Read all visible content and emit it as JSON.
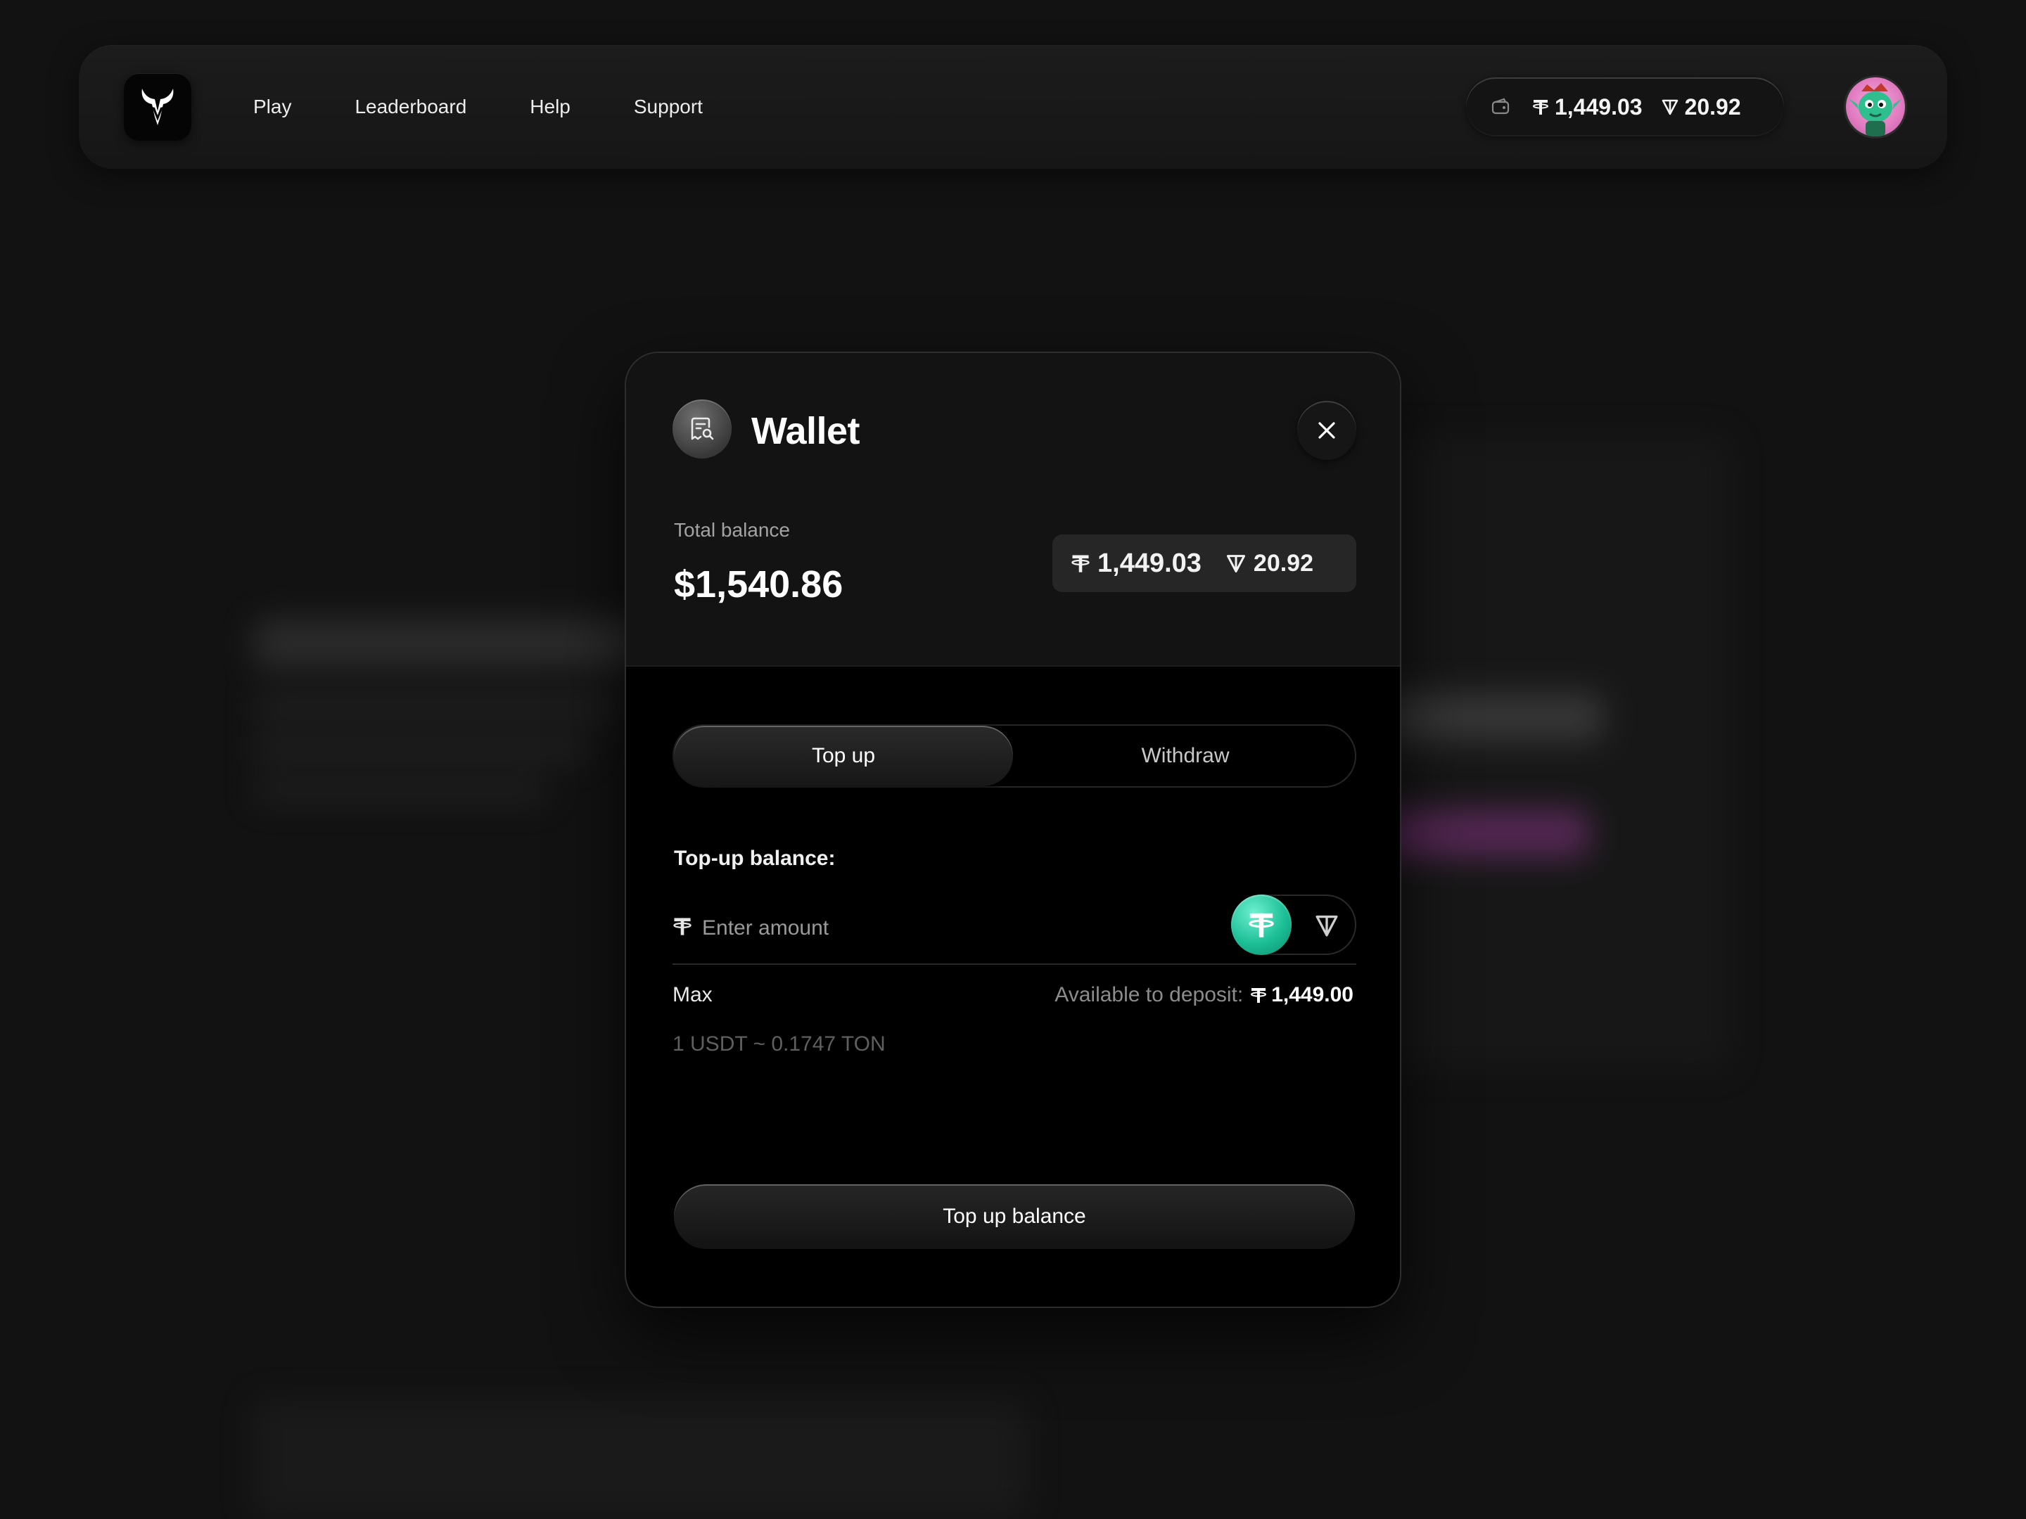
{
  "nav": {
    "items": [
      {
        "label": "Play"
      },
      {
        "label": "Leaderboard"
      },
      {
        "label": "Help"
      },
      {
        "label": "Support"
      }
    ],
    "balance": {
      "usdt": "1,449.03",
      "ton": "20.92"
    }
  },
  "modal": {
    "title": "Wallet",
    "total_label": "Total balance",
    "total_value": "$1,540.86",
    "coins": {
      "usdt": "1,449.03",
      "ton": "20.92"
    },
    "tabs": [
      {
        "label": "Top up",
        "active": true
      },
      {
        "label": "Withdraw",
        "active": false
      }
    ],
    "section_label": "Top-up balance:",
    "amount_placeholder": "Enter amount",
    "amount_value": "",
    "selected_currency": "USDT",
    "max_label": "Max",
    "available_label": "Available to deposit:",
    "available_value": "1,449.00",
    "rate": "1 USDT ~ 0.1747 TON",
    "submit_label": "Top up balance"
  },
  "icons": {
    "logo": "bull-logo-icon",
    "wallet": "wallet-icon",
    "usdt": "tether-icon",
    "ton": "ton-icon",
    "receipt": "receipt-search-icon",
    "close": "close-icon"
  },
  "colors": {
    "background": "#121212",
    "modal": "#000000",
    "usdt_accent": "#1cbf97",
    "avatar_bg": "#e07ac0"
  }
}
